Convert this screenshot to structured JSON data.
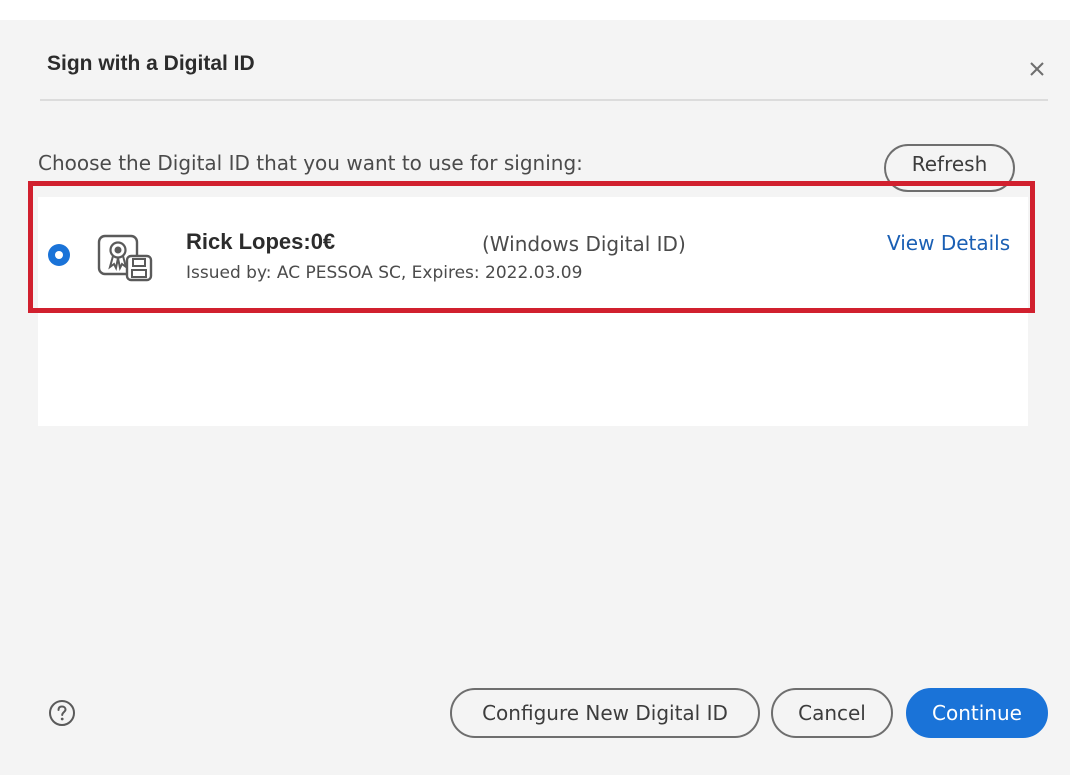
{
  "dialog": {
    "title": "Sign with a Digital ID",
    "close_icon": "close-icon"
  },
  "prompt": "Choose the Digital ID that you want to use for signing:",
  "refresh_label": "Refresh",
  "digital_ids": [
    {
      "selected": true,
      "icon": "certificate-icon",
      "name": "Rick Lopes:0€",
      "type": "(Windows Digital ID)",
      "issuer": "Issued by: AC PESSOA SC, Expires: 2022.03.09",
      "view_details_label": "View Details"
    }
  ],
  "colors": {
    "accent": "#1a73d8",
    "highlight": "#d1202e",
    "link": "#1a5fb4"
  },
  "footer": {
    "help_icon": "help-icon",
    "configure_label": "Configure New Digital ID",
    "cancel_label": "Cancel",
    "continue_label": "Continue"
  }
}
